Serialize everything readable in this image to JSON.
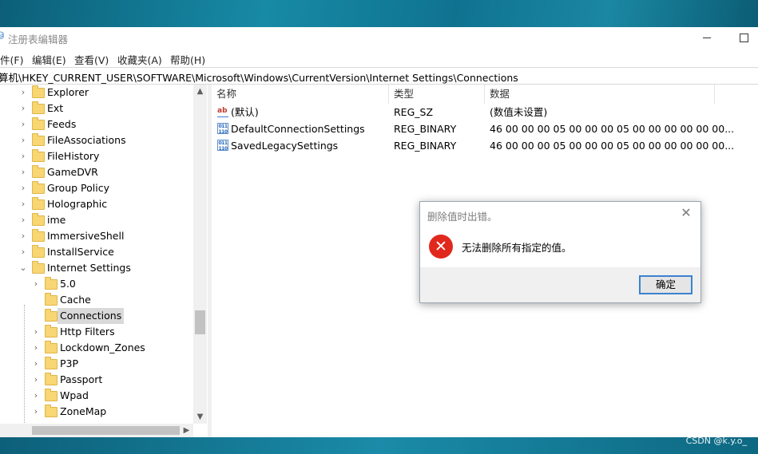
{
  "window": {
    "title": "注册表编辑器",
    "minimize_glyph": "",
    "maximize_glyph": ""
  },
  "menu": [
    "件(F)",
    "编辑(E)",
    "查看(V)",
    "收藏夹(A)",
    "帮助(H)"
  ],
  "address": "算机\\HKEY_CURRENT_USER\\SOFTWARE\\Microsoft\\Windows\\CurrentVersion\\Internet Settings\\Connections",
  "tree": {
    "items": [
      {
        "label": "Explorer",
        "level": 1
      },
      {
        "label": "Ext",
        "level": 1
      },
      {
        "label": "Feeds",
        "level": 1
      },
      {
        "label": "FileAssociations",
        "level": 1
      },
      {
        "label": "FileHistory",
        "level": 1
      },
      {
        "label": "GameDVR",
        "level": 1
      },
      {
        "label": "Group Policy",
        "level": 1
      },
      {
        "label": "Holographic",
        "level": 1
      },
      {
        "label": "ime",
        "level": 1
      },
      {
        "label": "ImmersiveShell",
        "level": 1
      },
      {
        "label": "InstallService",
        "level": 1
      },
      {
        "label": "Internet Settings",
        "level": 1,
        "expanded": true
      },
      {
        "label": "5.0",
        "level": 2
      },
      {
        "label": "Cache",
        "level": 2,
        "leaf": true
      },
      {
        "label": "Connections",
        "level": 2,
        "leaf": true,
        "selected": true
      },
      {
        "label": "Http Filters",
        "level": 2
      },
      {
        "label": "Lockdown_Zones",
        "level": 2
      },
      {
        "label": "P3P",
        "level": 2
      },
      {
        "label": "Passport",
        "level": 2
      },
      {
        "label": "Wpad",
        "level": 2
      },
      {
        "label": "ZoneMap",
        "level": 2
      }
    ]
  },
  "list": {
    "columns": [
      "名称",
      "类型",
      "数据"
    ],
    "rows": [
      {
        "icon": "string-value-icon",
        "name": "(默认)",
        "type": "REG_SZ",
        "data": "(数值未设置)"
      },
      {
        "icon": "binary-value-icon",
        "name": "DefaultConnectionSettings",
        "type": "REG_BINARY",
        "data": "46 00 00 00 05 00 00 00 05 00 00 00 00 00 00..."
      },
      {
        "icon": "binary-value-icon",
        "name": "SavedLegacySettings",
        "type": "REG_BINARY",
        "data": "46 00 00 00 05 00 00 00 05 00 00 00 00 00 00..."
      }
    ]
  },
  "dialog": {
    "title": "删除值时出错。",
    "message": "无法删除所有指定的值。",
    "ok_label": "确定"
  },
  "watermark": "CSDN @k.y.o_"
}
